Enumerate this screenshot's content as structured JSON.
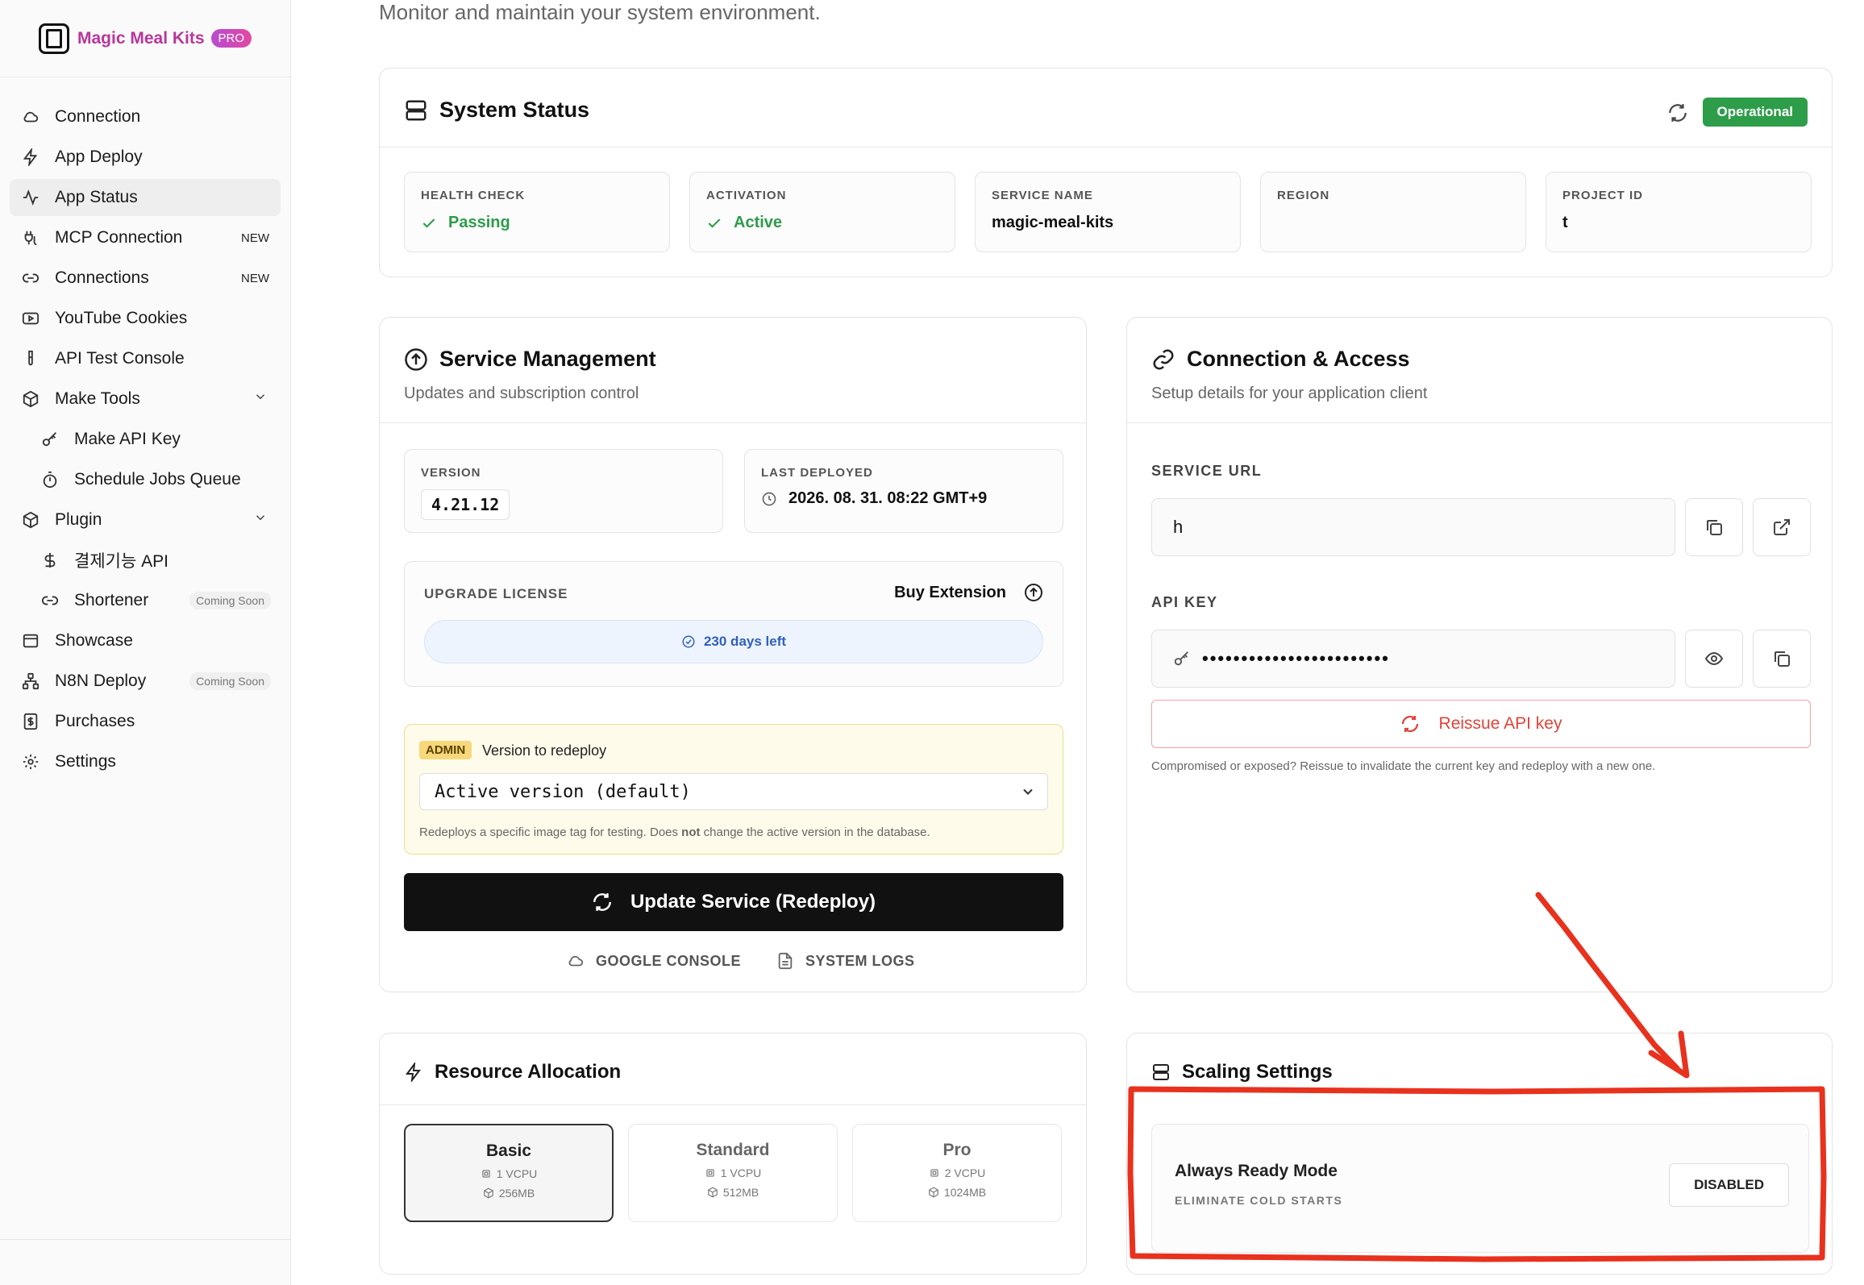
{
  "brand": {
    "name": "Magic Meal Kits",
    "badge": "PRO"
  },
  "sidebar": {
    "items": [
      {
        "label": "Connection",
        "icon": "cloud-icon"
      },
      {
        "label": "App Deploy",
        "icon": "bolt-icon"
      },
      {
        "label": "App Status",
        "icon": "activity-icon",
        "active": true
      },
      {
        "label": "MCP Connection",
        "icon": "plug-icon",
        "badge": "NEW"
      },
      {
        "label": "Connections",
        "icon": "link-icon",
        "badge": "NEW"
      },
      {
        "label": "YouTube Cookies",
        "icon": "youtube-icon"
      },
      {
        "label": "API Test Console",
        "icon": "test-tube-icon"
      },
      {
        "label": "Make Tools",
        "icon": "box-icon",
        "expandable": true
      },
      {
        "label": "Make API Key",
        "icon": "key-icon",
        "sub": true
      },
      {
        "label": "Schedule Jobs Queue",
        "icon": "timer-icon",
        "sub": true
      },
      {
        "label": "Plugin",
        "icon": "box-icon",
        "expandable": true
      },
      {
        "label": "결제기능 API",
        "icon": "dollar-icon",
        "sub": true
      },
      {
        "label": "Shortener",
        "icon": "link-icon",
        "sub": true,
        "soon": "Coming Soon"
      },
      {
        "label": "Showcase",
        "icon": "window-icon"
      },
      {
        "label": "N8N Deploy",
        "icon": "network-icon",
        "soon": "Coming Soon"
      },
      {
        "label": "Purchases",
        "icon": "receipt-icon"
      },
      {
        "label": "Settings",
        "icon": "gear-icon"
      }
    ]
  },
  "page": {
    "subtitle": "Monitor and maintain your system environment."
  },
  "system_status": {
    "title": "System Status",
    "status": "Operational",
    "stats": [
      {
        "label": "HEALTH CHECK",
        "value": "Passing",
        "ok": true
      },
      {
        "label": "ACTIVATION",
        "value": "Active",
        "ok": true
      },
      {
        "label": "SERVICE NAME",
        "value": "magic-meal-kits"
      },
      {
        "label": "REGION",
        "value": ""
      },
      {
        "label": "PROJECT ID",
        "value": "t"
      }
    ]
  },
  "service": {
    "title": "Service Management",
    "desc": "Updates and subscription control",
    "version_label": "VERSION",
    "version": "4.21.12",
    "deployed_label": "LAST DEPLOYED",
    "deployed": "2026. 08. 31. 08:22 GMT+9",
    "license_label": "UPGRADE LICENSE",
    "buy_label": "Buy Extension",
    "days_left": "230 days left",
    "admin_tag": "ADMIN",
    "redeploy_label": "Version to redeploy",
    "redeploy_value": "Active version (default)",
    "redeploy_note_a": "Redeploys a specific image tag for testing. Does ",
    "redeploy_note_b": "not",
    "redeploy_note_c": " change the active version in the database.",
    "update_btn": "Update Service (Redeploy)",
    "console_link": "GOOGLE CONSOLE",
    "logs_link": "SYSTEM LOGS"
  },
  "connection": {
    "title": "Connection & Access",
    "desc": "Setup details for your application client",
    "url_label": "SERVICE URL",
    "url_value": "h",
    "key_label": "API KEY",
    "key_masked": "••••••••••••••••••••••••",
    "reissue_btn": "Reissue API key",
    "reissue_note": "Compromised or exposed? Reissue to invalidate the current key and redeploy with a new one."
  },
  "resources": {
    "title": "Resource Allocation",
    "tiers": [
      {
        "name": "Basic",
        "cpu": "1 VCPU",
        "mem": "256MB",
        "selected": true
      },
      {
        "name": "Standard",
        "cpu": "1 VCPU",
        "mem": "512MB"
      },
      {
        "name": "Pro",
        "cpu": "2 VCPU",
        "mem": "1024MB"
      }
    ]
  },
  "scaling": {
    "title": "Scaling Settings",
    "mode_title": "Always Ready Mode",
    "mode_sub": "ELIMINATE COLD STARTS",
    "mode_state": "DISABLED"
  },
  "colors": {
    "brand": "#b8379a",
    "ok": "#2f9b4b",
    "danger": "#e0433a",
    "annotation": "#e8321e"
  }
}
